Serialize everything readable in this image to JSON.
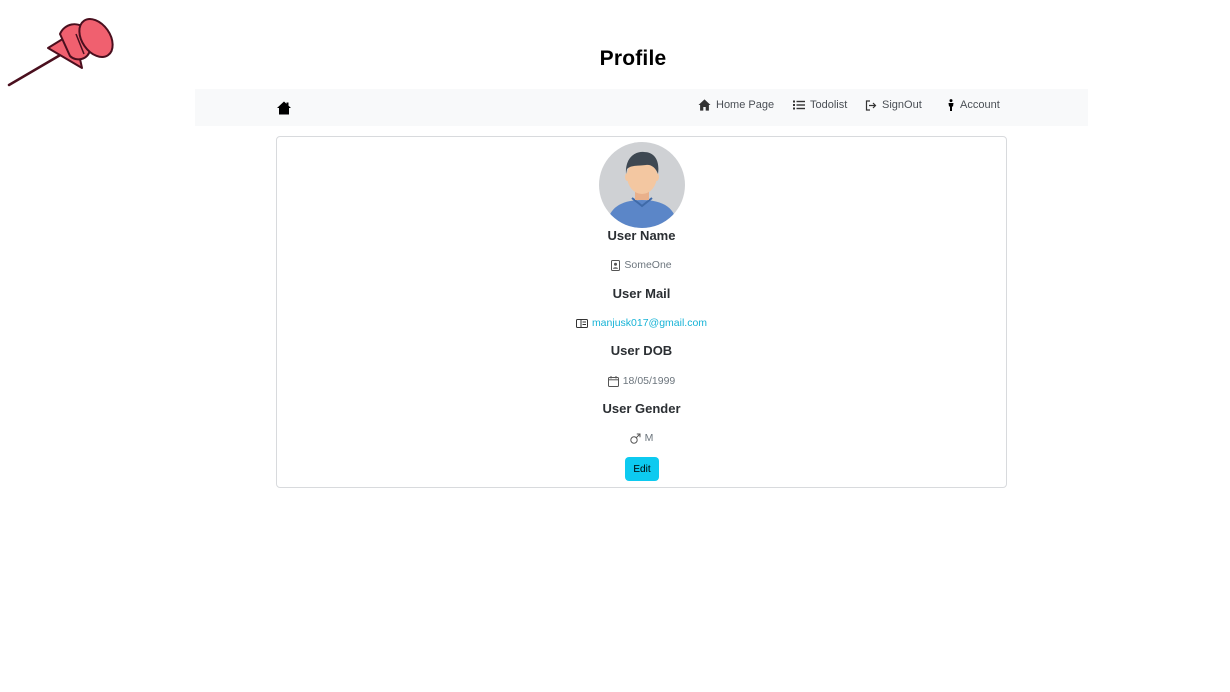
{
  "page": {
    "title": "Profile"
  },
  "navbar": {
    "brand_icon": "home-icon",
    "items": [
      {
        "label": "Home Page",
        "icon": "home-icon"
      },
      {
        "label": "Todolist",
        "icon": "list-icon"
      },
      {
        "label": "SignOut",
        "icon": "sign-out-icon"
      },
      {
        "label": "Account",
        "icon": "person-icon"
      }
    ]
  },
  "profile": {
    "fields": [
      {
        "label": "User Name",
        "value": "SomeOne",
        "icon": "person-badge-icon"
      },
      {
        "label": "User Mail",
        "value": "manjusk017@gmail.com",
        "icon": "mail-card-icon"
      },
      {
        "label": "User DOB",
        "value": "18/05/1999",
        "icon": "calendar-icon"
      },
      {
        "label": "User Gender",
        "value": "M",
        "icon": "male-symbol-icon"
      }
    ],
    "edit_label": "Edit"
  },
  "colors": {
    "accent": "#0dcaf0",
    "link": "#17b3d6",
    "pin": "#f0606f",
    "navbar_bg": "#f8f9fa"
  }
}
